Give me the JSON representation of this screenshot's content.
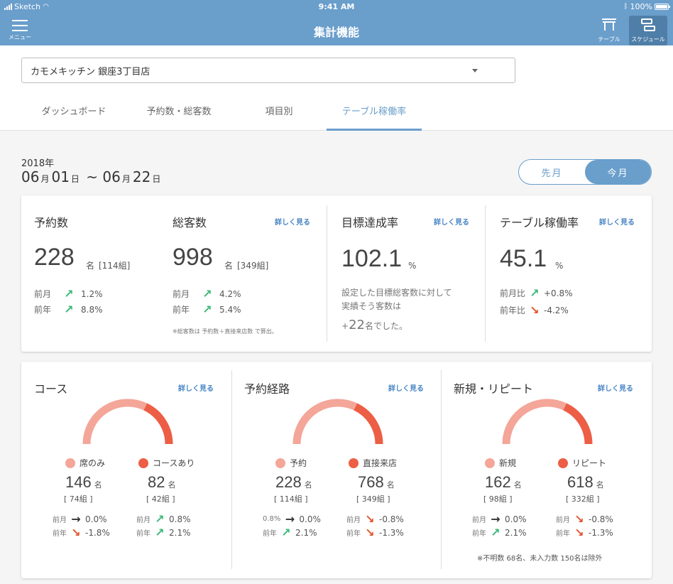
{
  "status": {
    "carrier": "Sketch",
    "time": "9:41 AM",
    "battery": "100%"
  },
  "nav": {
    "menu_label": "メニュー",
    "title": "集計機能",
    "table_label": "テーブル",
    "schedule_label": "スケジュール"
  },
  "store": {
    "selected": "カモメキッチン 銀座3丁目店"
  },
  "tabs": [
    {
      "label": "ダッシュボード"
    },
    {
      "label": "予約数・総客数"
    },
    {
      "label": "項目別"
    },
    {
      "label": "テーブル稼働率"
    }
  ],
  "period": {
    "year": "2018年",
    "start_month": "06",
    "start_day": "01",
    "end_month": "06",
    "end_day": "22",
    "month_unit": "月",
    "day_unit": "日",
    "tilde": "~"
  },
  "toggle": {
    "prev": "先月",
    "current": "今月"
  },
  "common": {
    "more": "詳しく見る",
    "person_unit": "名",
    "percent": "%"
  },
  "reservations": {
    "label": "予約数",
    "value": "228",
    "groups": "[114組]",
    "rows": [
      {
        "k": "前月",
        "v": "1.2%",
        "dir": "up"
      },
      {
        "k": "前年",
        "v": "8.8%",
        "dir": "up"
      }
    ]
  },
  "customers": {
    "label": "総客数",
    "value": "998",
    "groups": "[349組]",
    "rows": [
      {
        "k": "前月",
        "v": "4.2%",
        "dir": "up"
      },
      {
        "k": "前年",
        "v": "5.4%",
        "dir": "up"
      }
    ],
    "note": "※総客数は 予約数＋直接来店数 で算出。"
  },
  "target": {
    "label": "目標達成率",
    "value": "102.1",
    "desc1": "設定した目標総客数に対して",
    "desc2": "実績そう客数は",
    "plus": "+",
    "delta": "22",
    "delta_suffix": "名でした。"
  },
  "occupancy": {
    "label": "テーブル稼働率",
    "value": "45.1",
    "rows": [
      {
        "k": "前月比",
        "v": "+0.8%",
        "dir": "up"
      },
      {
        "k": "前年比",
        "v": "-4.2%",
        "dir": "down"
      }
    ]
  },
  "colors": {
    "light": "#f4a699",
    "dark": "#ec5e45",
    "accent": "#6a9ecb",
    "up": "#3cb878",
    "down": "#e2552f"
  },
  "sections": [
    {
      "title": "コース",
      "share_dark": 0.36,
      "a": {
        "name": "席のみ",
        "value": "146",
        "groups": "[ 74組 ]",
        "r1k": "前月",
        "r1v": "0.0%",
        "r1d": "flat",
        "r2k": "前年",
        "r2v": "-1.8%",
        "r2d": "down"
      },
      "b": {
        "name": "コースあり",
        "value": "82",
        "groups": "[ 42組 ]",
        "r1k": "前月",
        "r1v": "0.8%",
        "r1d": "up",
        "r2k": "前年",
        "r2v": "2.1%",
        "r2d": "up"
      }
    },
    {
      "title": "予約経路",
      "share_dark": 0.36,
      "a": {
        "name": "予約",
        "value": "228",
        "groups": "[ 114組 ]",
        "r1k": "0.8%",
        "r1v": "0.0%",
        "r1d": "flat",
        "r2k": "前年",
        "r2v": "2.1%",
        "r2d": "up"
      },
      "b": {
        "name": "直接来店",
        "value": "768",
        "groups": "[ 349組 ]",
        "r1k": "前月",
        "r1v": "-0.8%",
        "r1d": "down",
        "r2k": "前年",
        "r2v": "-1.3%",
        "r2d": "down"
      }
    },
    {
      "title": "新規・リピート",
      "share_dark": 0.36,
      "a": {
        "name": "新規",
        "value": "162",
        "groups": "[ 98組 ]",
        "r1k": "前月",
        "r1v": "0.0%",
        "r1d": "flat",
        "r2k": "前年",
        "r2v": "2.1%",
        "r2d": "up"
      },
      "b": {
        "name": "リピート",
        "value": "618",
        "groups": "[ 332組 ]",
        "r1k": "前月",
        "r1v": "-0.8%",
        "r1d": "down",
        "r2k": "前年",
        "r2v": "-1.3%",
        "r2d": "down"
      },
      "note": "※不明数 68名、未入力数 150名は除外"
    }
  ]
}
